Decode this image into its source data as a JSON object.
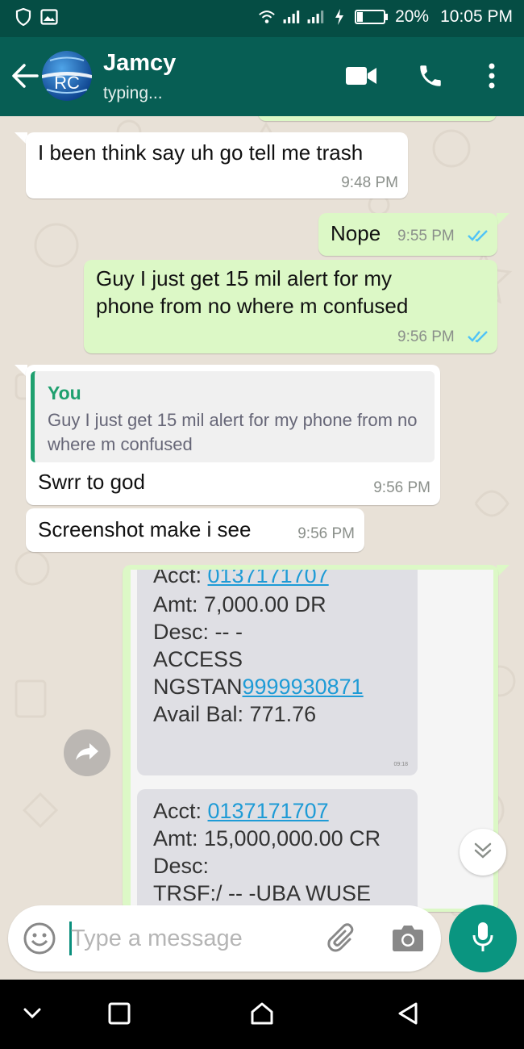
{
  "status_bar": {
    "battery": "20%",
    "time": "10:05 PM"
  },
  "header": {
    "contact_name": "Jamcy",
    "status": "typing...",
    "avatar_text": "RC"
  },
  "messages": [
    {
      "text": "I been think say uh go tell me trash",
      "time": "9:48 PM"
    },
    {
      "text": "Nope",
      "time": "9:55 PM"
    },
    {
      "line1": "Guy I just get 15 mil alert for my",
      "line2": "phone from no where m confused",
      "time": "9:56 PM"
    },
    {
      "quote_author": "You",
      "quote_text": "Guy I just get 15 mil alert for my phone from no where m confused",
      "text": "Swrr to god",
      "time": "9:56 PM"
    },
    {
      "text": "Screenshot make i see",
      "time": "9:56 PM"
    }
  ],
  "image_message": {
    "sms1": {
      "acct_label": "Acct: ",
      "acct_number": "0137171707",
      "amount": "Amt: 7,000.00 DR",
      "desc": "Desc: -- -",
      "line4": "ACCESS",
      "ngstan_label": "NGSTAN",
      "ngstan_number": "9999930871",
      "balance": "Avail Bal: 771.76",
      "time": "09:18"
    },
    "sms2": {
      "acct_label": "Acct: ",
      "acct_number": "0137171707",
      "amount": "Amt: 15,000,000.00 CR",
      "desc": "Desc:",
      "line4": "TRSF:/ -- -UBA WUSE"
    }
  },
  "input": {
    "placeholder": "Type a message"
  },
  "colors": {
    "header": "#075e54",
    "status_bar": "#054d44",
    "outgoing": "#dcf8c6",
    "incoming": "#ffffff",
    "accent": "#0a9580",
    "read_ticks": "#4fc3f7"
  }
}
